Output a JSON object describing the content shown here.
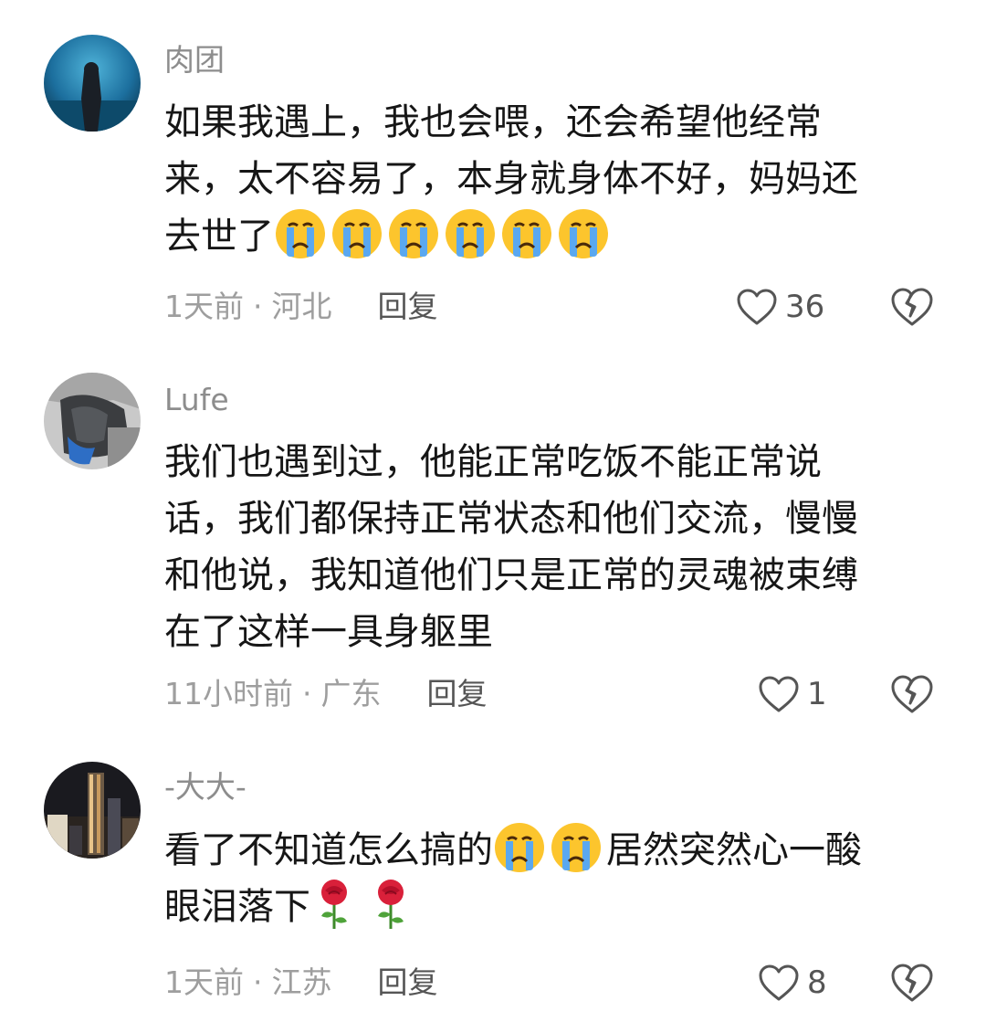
{
  "colors": {
    "text": "#161616",
    "meta": "#9e9e9e",
    "username": "#8d8d8d",
    "reply": "#555555",
    "icon": "#555555"
  },
  "comments": [
    {
      "username": "肉团",
      "avatar": "avatar-aquarium-figure",
      "lines": [
        "如果我遇上，我也会喂，还会希望他经常",
        "来，太不容易了，本身就身体不好，妈妈还",
        "去世了"
      ],
      "emojis": [
        "crying-face-icon",
        "crying-face-icon",
        "crying-face-icon",
        "crying-face-icon",
        "crying-face-icon",
        "crying-face-icon"
      ],
      "time": "1天前",
      "location": "河北",
      "reply_label": "回复",
      "like_count": "36"
    },
    {
      "username": "Lufe",
      "avatar": "avatar-jacket-person",
      "lines": [
        "我们也遇到过，他能正常吃饭不能正常说",
        "话，我们都保持正常状态和他们交流，慢慢",
        "和他说，我知道他们只是正常的灵魂被束缚",
        "在了这样一具身躯里"
      ],
      "time": "11小时前",
      "location": "广东",
      "reply_label": "回复",
      "like_count": "1"
    },
    {
      "username": "-大大-",
      "avatar": "avatar-night-skyline",
      "line1_before": "看了不知道怎么搞的",
      "line1_after": "居然突然心一酸",
      "line2": "眼泪落下",
      "emojis": [
        "crying-face-icon",
        "crying-face-icon",
        "rose-icon",
        "rose-icon"
      ],
      "time": "1天前",
      "location": "江苏",
      "reply_label": "回复",
      "like_count": "8"
    }
  ],
  "separator": "·"
}
